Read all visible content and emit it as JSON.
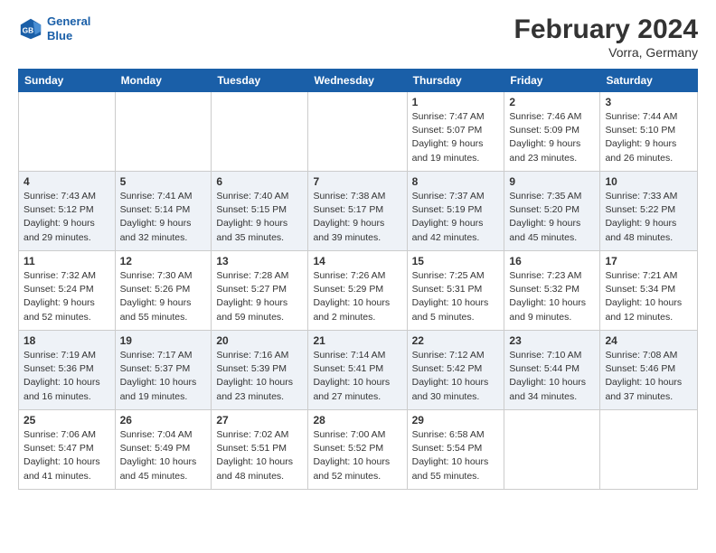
{
  "header": {
    "logo_line1": "General",
    "logo_line2": "Blue",
    "title": "February 2024",
    "subtitle": "Vorra, Germany"
  },
  "weekdays": [
    "Sunday",
    "Monday",
    "Tuesday",
    "Wednesday",
    "Thursday",
    "Friday",
    "Saturday"
  ],
  "weeks": [
    [
      {
        "day": "",
        "sunrise": "",
        "sunset": "",
        "daylight": ""
      },
      {
        "day": "",
        "sunrise": "",
        "sunset": "",
        "daylight": ""
      },
      {
        "day": "",
        "sunrise": "",
        "sunset": "",
        "daylight": ""
      },
      {
        "day": "",
        "sunrise": "",
        "sunset": "",
        "daylight": ""
      },
      {
        "day": "1",
        "sunrise": "Sunrise: 7:47 AM",
        "sunset": "Sunset: 5:07 PM",
        "daylight": "Daylight: 9 hours and 19 minutes."
      },
      {
        "day": "2",
        "sunrise": "Sunrise: 7:46 AM",
        "sunset": "Sunset: 5:09 PM",
        "daylight": "Daylight: 9 hours and 23 minutes."
      },
      {
        "day": "3",
        "sunrise": "Sunrise: 7:44 AM",
        "sunset": "Sunset: 5:10 PM",
        "daylight": "Daylight: 9 hours and 26 minutes."
      }
    ],
    [
      {
        "day": "4",
        "sunrise": "Sunrise: 7:43 AM",
        "sunset": "Sunset: 5:12 PM",
        "daylight": "Daylight: 9 hours and 29 minutes."
      },
      {
        "day": "5",
        "sunrise": "Sunrise: 7:41 AM",
        "sunset": "Sunset: 5:14 PM",
        "daylight": "Daylight: 9 hours and 32 minutes."
      },
      {
        "day": "6",
        "sunrise": "Sunrise: 7:40 AM",
        "sunset": "Sunset: 5:15 PM",
        "daylight": "Daylight: 9 hours and 35 minutes."
      },
      {
        "day": "7",
        "sunrise": "Sunrise: 7:38 AM",
        "sunset": "Sunset: 5:17 PM",
        "daylight": "Daylight: 9 hours and 39 minutes."
      },
      {
        "day": "8",
        "sunrise": "Sunrise: 7:37 AM",
        "sunset": "Sunset: 5:19 PM",
        "daylight": "Daylight: 9 hours and 42 minutes."
      },
      {
        "day": "9",
        "sunrise": "Sunrise: 7:35 AM",
        "sunset": "Sunset: 5:20 PM",
        "daylight": "Daylight: 9 hours and 45 minutes."
      },
      {
        "day": "10",
        "sunrise": "Sunrise: 7:33 AM",
        "sunset": "Sunset: 5:22 PM",
        "daylight": "Daylight: 9 hours and 48 minutes."
      }
    ],
    [
      {
        "day": "11",
        "sunrise": "Sunrise: 7:32 AM",
        "sunset": "Sunset: 5:24 PM",
        "daylight": "Daylight: 9 hours and 52 minutes."
      },
      {
        "day": "12",
        "sunrise": "Sunrise: 7:30 AM",
        "sunset": "Sunset: 5:26 PM",
        "daylight": "Daylight: 9 hours and 55 minutes."
      },
      {
        "day": "13",
        "sunrise": "Sunrise: 7:28 AM",
        "sunset": "Sunset: 5:27 PM",
        "daylight": "Daylight: 9 hours and 59 minutes."
      },
      {
        "day": "14",
        "sunrise": "Sunrise: 7:26 AM",
        "sunset": "Sunset: 5:29 PM",
        "daylight": "Daylight: 10 hours and 2 minutes."
      },
      {
        "day": "15",
        "sunrise": "Sunrise: 7:25 AM",
        "sunset": "Sunset: 5:31 PM",
        "daylight": "Daylight: 10 hours and 5 minutes."
      },
      {
        "day": "16",
        "sunrise": "Sunrise: 7:23 AM",
        "sunset": "Sunset: 5:32 PM",
        "daylight": "Daylight: 10 hours and 9 minutes."
      },
      {
        "day": "17",
        "sunrise": "Sunrise: 7:21 AM",
        "sunset": "Sunset: 5:34 PM",
        "daylight": "Daylight: 10 hours and 12 minutes."
      }
    ],
    [
      {
        "day": "18",
        "sunrise": "Sunrise: 7:19 AM",
        "sunset": "Sunset: 5:36 PM",
        "daylight": "Daylight: 10 hours and 16 minutes."
      },
      {
        "day": "19",
        "sunrise": "Sunrise: 7:17 AM",
        "sunset": "Sunset: 5:37 PM",
        "daylight": "Daylight: 10 hours and 19 minutes."
      },
      {
        "day": "20",
        "sunrise": "Sunrise: 7:16 AM",
        "sunset": "Sunset: 5:39 PM",
        "daylight": "Daylight: 10 hours and 23 minutes."
      },
      {
        "day": "21",
        "sunrise": "Sunrise: 7:14 AM",
        "sunset": "Sunset: 5:41 PM",
        "daylight": "Daylight: 10 hours and 27 minutes."
      },
      {
        "day": "22",
        "sunrise": "Sunrise: 7:12 AM",
        "sunset": "Sunset: 5:42 PM",
        "daylight": "Daylight: 10 hours and 30 minutes."
      },
      {
        "day": "23",
        "sunrise": "Sunrise: 7:10 AM",
        "sunset": "Sunset: 5:44 PM",
        "daylight": "Daylight: 10 hours and 34 minutes."
      },
      {
        "day": "24",
        "sunrise": "Sunrise: 7:08 AM",
        "sunset": "Sunset: 5:46 PM",
        "daylight": "Daylight: 10 hours and 37 minutes."
      }
    ],
    [
      {
        "day": "25",
        "sunrise": "Sunrise: 7:06 AM",
        "sunset": "Sunset: 5:47 PM",
        "daylight": "Daylight: 10 hours and 41 minutes."
      },
      {
        "day": "26",
        "sunrise": "Sunrise: 7:04 AM",
        "sunset": "Sunset: 5:49 PM",
        "daylight": "Daylight: 10 hours and 45 minutes."
      },
      {
        "day": "27",
        "sunrise": "Sunrise: 7:02 AM",
        "sunset": "Sunset: 5:51 PM",
        "daylight": "Daylight: 10 hours and 48 minutes."
      },
      {
        "day": "28",
        "sunrise": "Sunrise: 7:00 AM",
        "sunset": "Sunset: 5:52 PM",
        "daylight": "Daylight: 10 hours and 52 minutes."
      },
      {
        "day": "29",
        "sunrise": "Sunrise: 6:58 AM",
        "sunset": "Sunset: 5:54 PM",
        "daylight": "Daylight: 10 hours and 55 minutes."
      },
      {
        "day": "",
        "sunrise": "",
        "sunset": "",
        "daylight": ""
      },
      {
        "day": "",
        "sunrise": "",
        "sunset": "",
        "daylight": ""
      }
    ]
  ]
}
